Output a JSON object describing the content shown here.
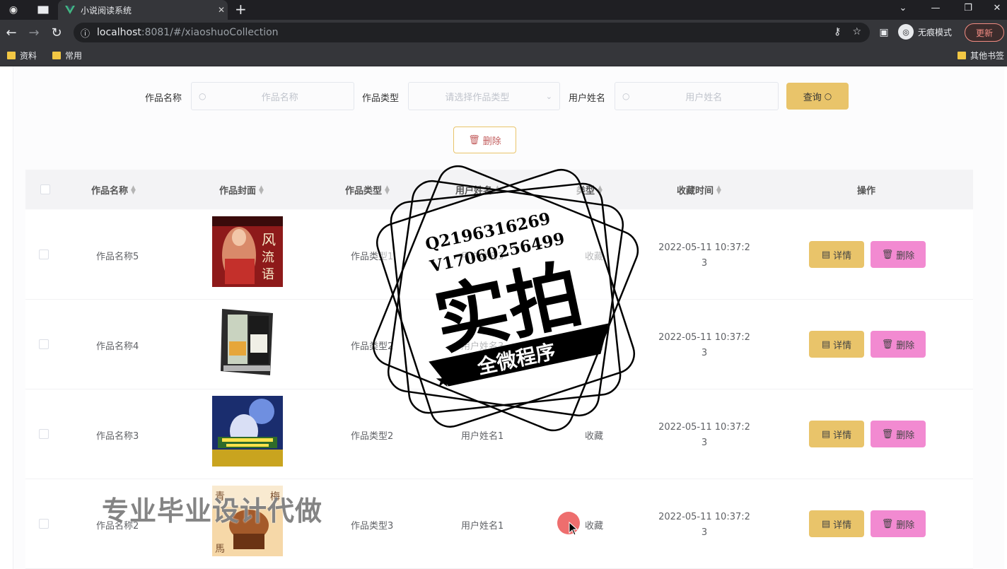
{
  "browser": {
    "tab_title": "小说阅读系统",
    "url_host": "localhost",
    "url_rest": ":8081/#/xiaoshuoCollection",
    "profile_label": "无痕模式",
    "update_label": "更新",
    "bookmarks": [
      "资料",
      "常用"
    ],
    "other_bookmarks": "其他书签"
  },
  "search": {
    "name_label": "作品名称",
    "name_placeholder": "作品名称",
    "type_label": "作品类型",
    "type_placeholder": "请选择作品类型",
    "user_label": "用户姓名",
    "user_placeholder": "用户姓名",
    "query_button": "查询"
  },
  "toolbar": {
    "delete_button": "删除"
  },
  "table": {
    "headers": [
      "作品名称",
      "作品封面",
      "作品类型",
      "用户姓名",
      "类型",
      "收藏时间",
      "操作"
    ],
    "rows": [
      {
        "name": "作品名称5",
        "category": "作品类型1",
        "user": "用户姓名3",
        "type": "收藏",
        "time": "2022-05-11 10:37:2",
        "time2": "3"
      },
      {
        "name": "作品名称4",
        "category": "作品类型2",
        "user": "用户姓名3",
        "type": "收藏",
        "time": "2022-05-11 10:37:2",
        "time2": "3"
      },
      {
        "name": "作品名称3",
        "category": "作品类型2",
        "user": "用户姓名1",
        "type": "收藏",
        "time": "2022-05-11 10:37:2",
        "time2": "3"
      },
      {
        "name": "作品名称2",
        "category": "作品类型3",
        "user": "用户姓名1",
        "type": "收藏",
        "time": "2022-05-11 10:37:2",
        "time2": "3"
      }
    ],
    "detail_button": "详情",
    "delete_button": "删除"
  },
  "watermark": {
    "line1": "Q2196316269",
    "line2": "V17060256499",
    "big": "实拍",
    "ribbon": "全微程序",
    "banner": "专业毕业设计代做"
  },
  "colors": {
    "accent_yellow": "#e9c46a",
    "accent_pink": "#f28ad1",
    "chrome_dark": "#35363a"
  }
}
